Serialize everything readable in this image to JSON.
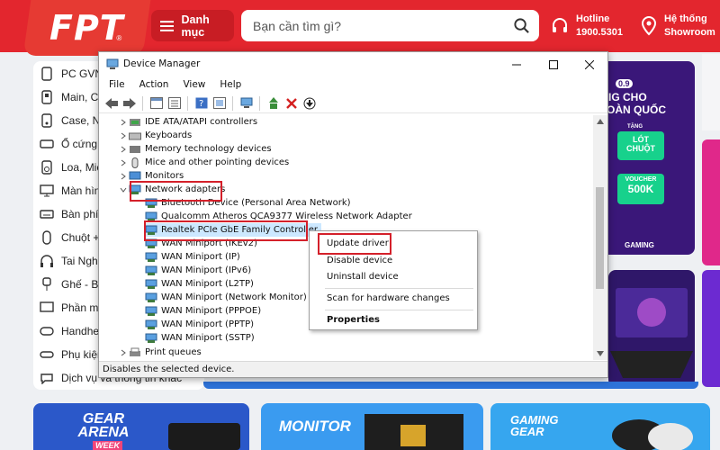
{
  "site": {
    "logo": "FPT",
    "logo_mark": "®",
    "category_button": "Danh mục",
    "search_placeholder": "Bạn cần tìm gì?",
    "hotline_label": "Hotline",
    "hotline_number": "1900.5301",
    "showroom_line1": "Hệ thống",
    "showroom_line2": "Showroom",
    "brand_color": "#e3262e"
  },
  "menu": {
    "items": [
      {
        "label": "PC GVN",
        "icon": "pc-icon"
      },
      {
        "label": "Main, CP",
        "icon": "mainboard-icon"
      },
      {
        "label": "Case, N",
        "icon": "case-icon"
      },
      {
        "label": "Ổ cứng,",
        "icon": "drive-icon"
      },
      {
        "label": "Loa, Mic",
        "icon": "speaker-icon"
      },
      {
        "label": "Màn hình",
        "icon": "monitor-icon"
      },
      {
        "label": "Bàn phím",
        "icon": "keyboard-icon"
      },
      {
        "label": "Chuột +",
        "icon": "mouse-icon"
      },
      {
        "label": "Tai Nghe",
        "icon": "headphone-icon"
      },
      {
        "label": "Ghế - Bà",
        "icon": "chair-icon"
      },
      {
        "label": "Phần mề",
        "icon": "software-icon"
      },
      {
        "label": "Handhel",
        "icon": "gamepad-icon"
      },
      {
        "label": "Phụ kiện",
        "icon": "accessory-icon"
      },
      {
        "label": "Dịch vụ và thông tin khác",
        "icon": "service-icon"
      }
    ]
  },
  "banners": {
    "right_top_lines": [
      "0.9",
      "IG CHO",
      "OÀN QUỐC"
    ],
    "tang": "TẶNG",
    "lot_chuot_1": "LÓT",
    "lot_chuot_2": "CHUỘT",
    "voucher_label": "VOUCHER",
    "voucher_value": "500K",
    "gaming_text": "GAMING",
    "bottom": [
      "GEAR ARENA",
      "MONITOR",
      "GAMING GEAR"
    ],
    "bottom_sub": "WEEK"
  },
  "window": {
    "title": "Device Manager",
    "menu": [
      "File",
      "Action",
      "View",
      "Help"
    ],
    "status": "Disables the selected device.",
    "tree": [
      {
        "label": "IDE ATA/ATAPI controllers",
        "level": 0,
        "icon": "ide-icon"
      },
      {
        "label": "Keyboards",
        "level": 0,
        "icon": "keyboard-icon"
      },
      {
        "label": "Memory technology devices",
        "level": 0,
        "icon": "memory-icon"
      },
      {
        "label": "Mice and other pointing devices",
        "level": 0,
        "icon": "mouse-icon"
      },
      {
        "label": "Monitors",
        "level": 0,
        "icon": "monitor-icon"
      },
      {
        "label": "Network adapters",
        "level": 0,
        "icon": "network-icon",
        "expanded": true
      },
      {
        "label": "Bluetooth Device (Personal Area Network)",
        "level": 1,
        "icon": "network-icon"
      },
      {
        "label": "Qualcomm Atheros QCA9377 Wireless Network Adapter",
        "level": 1,
        "icon": "network-icon"
      },
      {
        "label": "Realtek PCIe GbE Family Controller",
        "level": 1,
        "icon": "network-icon",
        "selected": true
      },
      {
        "label": "WAN Miniport (IKEv2)",
        "level": 1,
        "icon": "network-icon"
      },
      {
        "label": "WAN Miniport (IP)",
        "level": 1,
        "icon": "network-icon"
      },
      {
        "label": "WAN Miniport (IPv6)",
        "level": 1,
        "icon": "network-icon"
      },
      {
        "label": "WAN Miniport (L2TP)",
        "level": 1,
        "icon": "network-icon"
      },
      {
        "label": "WAN Miniport (Network Monitor)",
        "level": 1,
        "icon": "network-icon"
      },
      {
        "label": "WAN Miniport (PPPOE)",
        "level": 1,
        "icon": "network-icon"
      },
      {
        "label": "WAN Miniport (PPTP)",
        "level": 1,
        "icon": "network-icon"
      },
      {
        "label": "WAN Miniport (SSTP)",
        "level": 1,
        "icon": "network-icon"
      },
      {
        "label": "Print queues",
        "level": 0,
        "icon": "printer-icon"
      }
    ]
  },
  "context_menu": {
    "update": "Update driver",
    "disable": "Disable device",
    "uninstall": "Uninstall device",
    "scan": "Scan for hardware changes",
    "properties": "Properties"
  },
  "colors": {
    "highlight_box": "#d4202a",
    "selection": "#cce8ff"
  }
}
